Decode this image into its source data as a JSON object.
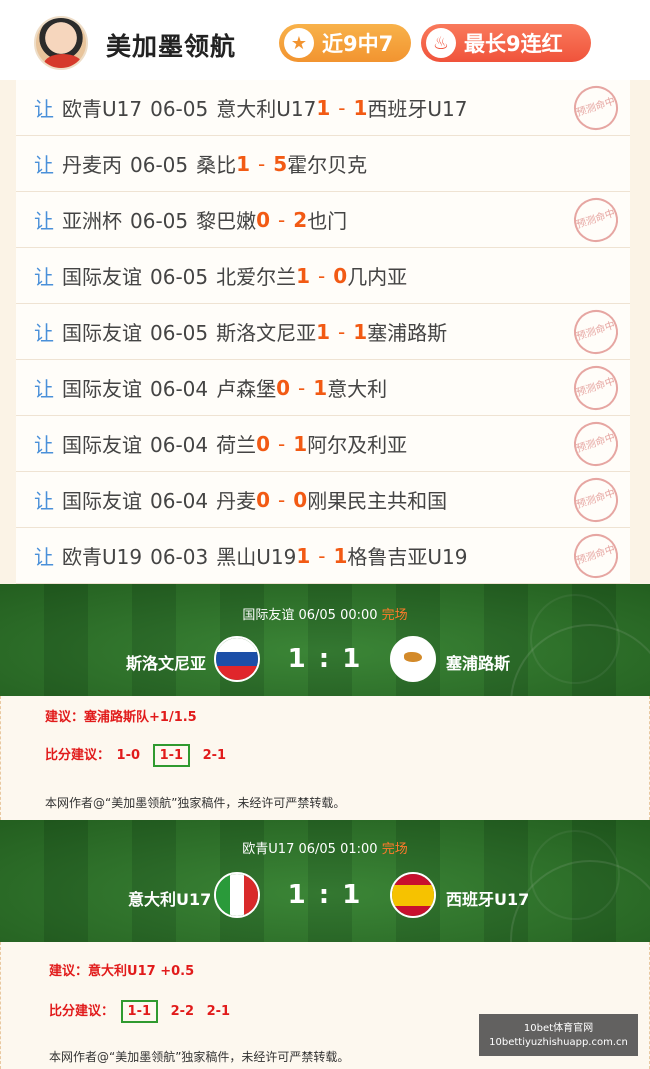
{
  "header": {
    "author": "美加墨领航",
    "badges": [
      {
        "label": "近9中7",
        "icon": "star-icon"
      },
      {
        "label": "最长9连红",
        "icon": "flame-icon"
      }
    ]
  },
  "history": [
    {
      "tag": "让",
      "league": "欧青U17",
      "date": "06-05",
      "home": "意大利U17",
      "hs": "1",
      "as": "1",
      "away": "西班牙U17",
      "stamp": "预测命中"
    },
    {
      "tag": "让",
      "league": "丹麦丙",
      "date": "06-05",
      "home": "桑比",
      "hs": "1",
      "as": "5",
      "away": "霍尔贝克",
      "stamp": ""
    },
    {
      "tag": "让",
      "league": "亚洲杯",
      "date": "06-05",
      "home": "黎巴嫩",
      "hs": "0",
      "as": "2",
      "away": "也门",
      "stamp": "预测命中"
    },
    {
      "tag": "让",
      "league": "国际友谊",
      "date": "06-05",
      "home": "北爱尔兰",
      "hs": "1",
      "as": "0",
      "away": "几内亚",
      "stamp": ""
    },
    {
      "tag": "让",
      "league": "国际友谊",
      "date": "06-05",
      "home": "斯洛文尼亚",
      "hs": "1",
      "as": "1",
      "away": "塞浦路斯",
      "stamp": "预测命中"
    },
    {
      "tag": "让",
      "league": "国际友谊",
      "date": "06-04",
      "home": "卢森堡",
      "hs": "0",
      "as": "1",
      "away": "意大利",
      "stamp": "预测命中"
    },
    {
      "tag": "让",
      "league": "国际友谊",
      "date": "06-04",
      "home": "荷兰",
      "hs": "0",
      "as": "1",
      "away": "阿尔及利亚",
      "stamp": "预测命中"
    },
    {
      "tag": "让",
      "league": "国际友谊",
      "date": "06-04",
      "home": "丹麦",
      "hs": "0",
      "as": "0",
      "away": "刚果民主共和国",
      "stamp": "预测命中"
    },
    {
      "tag": "让",
      "league": "欧青U19",
      "date": "06-03",
      "home": "黑山U19",
      "hs": "1",
      "as": "1",
      "away": "格鲁吉亚U19",
      "stamp": "预测命中"
    }
  ],
  "matches": [
    {
      "league": "国际友谊",
      "datetime": "06/05 00:00",
      "status": "完场",
      "home": "斯洛文尼亚",
      "away": "塞浦路斯",
      "score": "1 : 1",
      "advice_label": "建议：",
      "advice": "塞浦路斯队+1/1.5",
      "score_label": "比分建议：",
      "scores": [
        "1-0",
        "1-1",
        "2-1"
      ],
      "highlight": 1,
      "copyright": "本网作者@“美加墨领航”独家稿件，未经许可严禁转载。"
    },
    {
      "league": "欧青U17",
      "datetime": "06/05 01:00",
      "status": "完场",
      "home": "意大利U17",
      "away": "西班牙U17",
      "score": "1 : 1",
      "advice_label": "建议：",
      "advice": "意大利U17  +0.5",
      "score_label": "比分建议：",
      "scores": [
        "1-1",
        "2-2",
        "2-1"
      ],
      "highlight": 0,
      "copyright": "本网作者@“美加墨领航”独家稿件，未经许可严禁转载。"
    }
  ],
  "watermark": {
    "line1": "10bet体育官网",
    "line2": "10bettiyuzhishuapp.com.cn"
  }
}
